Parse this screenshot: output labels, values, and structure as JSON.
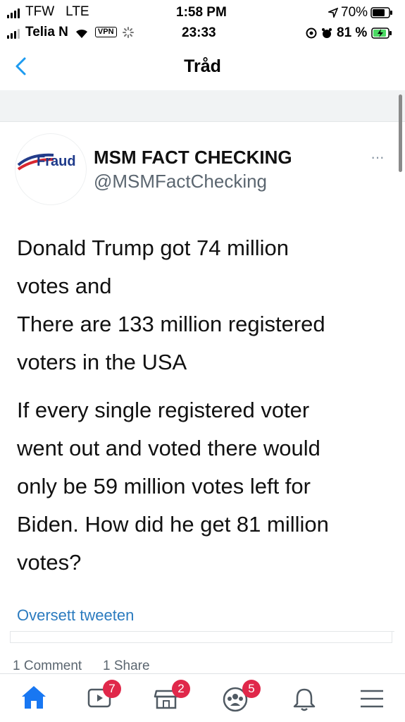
{
  "status_outer": {
    "carrier": "TFW",
    "network": "LTE",
    "time": "1:58 PM",
    "battery": "70%"
  },
  "status_inner": {
    "carrier": "Telia N",
    "vpn": "VPN",
    "time": "23:33",
    "battery": "81 %"
  },
  "nav": {
    "title": "Tråd"
  },
  "tweet": {
    "avatar_text": "Fraud",
    "display_name": "MSM FACT CHECKING",
    "handle": "@MSMFactChecking",
    "lines": [
      "Donald Trump got 74 million",
      "votes and",
      "There are 133 million registered",
      "voters in the USA",
      "If every single registered voter",
      "went out and voted there would",
      "only be 59 million votes left for",
      "Biden. How did he get 81 million",
      "votes?"
    ],
    "translate": "Oversett tweeten"
  },
  "facebook": {
    "comments": "1 Comment",
    "shares": "1 Share",
    "badges": {
      "watch": "7",
      "marketplace": "2",
      "groups": "5"
    }
  },
  "colors": {
    "accent": "#1d9bf0",
    "fb_blue": "#1877f2",
    "badge": "#e0284a",
    "link": "#2b7bbf"
  }
}
